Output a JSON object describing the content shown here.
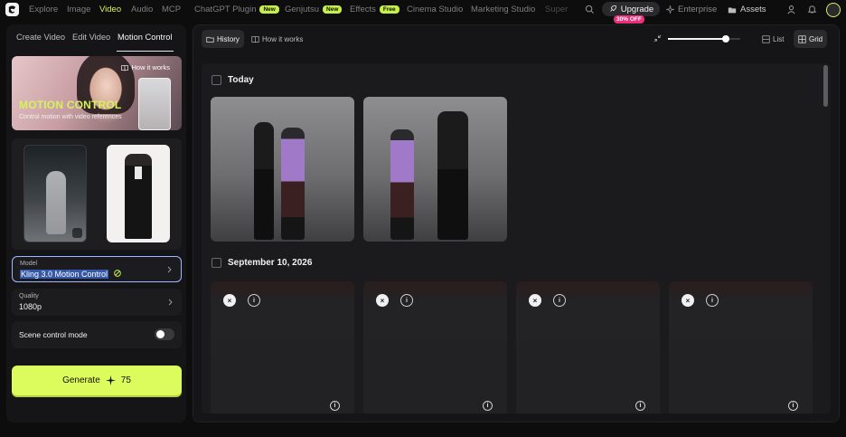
{
  "topnav": {
    "items": [
      {
        "label": "Explore",
        "badge": ""
      },
      {
        "label": "Image",
        "badge": ""
      },
      {
        "label": "Video",
        "badge": ""
      },
      {
        "label": "Audio",
        "badge": ""
      },
      {
        "label": "MCP",
        "badge": ""
      },
      {
        "label": "ChatGPT Plugin",
        "badge": "New"
      },
      {
        "label": "Genjutsu",
        "badge": "New"
      },
      {
        "label": "Effects",
        "badge": "Free"
      },
      {
        "label": "Cinema Studio",
        "badge": ""
      },
      {
        "label": "Marketing Studio",
        "badge": ""
      },
      {
        "label": "Super",
        "badge": ""
      }
    ],
    "upgrade_label": "Upgrade",
    "upgrade_badge": "30% OFF",
    "enterprise_label": "Enterprise",
    "assets_label": "Assets",
    "accent": "#d6f25a",
    "icons": [
      "logo-icon",
      "search-icon",
      "rocket-icon",
      "sparkle-icon",
      "folder-icon",
      "user-icon",
      "bell-icon"
    ]
  },
  "left": {
    "tabs": [
      "Create Video",
      "Edit Video",
      "Motion Control"
    ],
    "active_tab": "Motion Control",
    "hero": {
      "title": "MOTION CONTROL",
      "subtitle": "Control motion with video references",
      "how_label": "How it works"
    },
    "model": {
      "label": "Model",
      "value": "Kling 3.0 Motion Control"
    },
    "quality": {
      "label": "Quality",
      "value": "1080p"
    },
    "scene_control": {
      "label": "Scene control mode",
      "enabled": false
    },
    "generate": {
      "label": "Generate",
      "cost": "75"
    }
  },
  "right": {
    "history_label": "History",
    "how_label": "How it works",
    "list_label": "List",
    "grid_label": "Grid",
    "zoom": 0.8,
    "sections": [
      {
        "title": "Today",
        "items": 2
      },
      {
        "title": "September 10, 2026",
        "items": 4
      }
    ]
  }
}
